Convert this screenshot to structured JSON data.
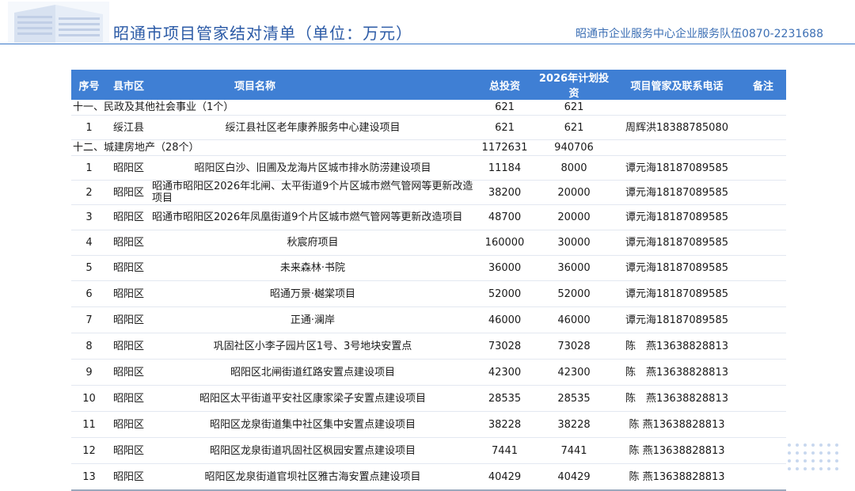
{
  "header": {
    "title": "昭通市项目管家结对清单（单位：万元）",
    "contact": "昭通市企业服务中心企业服务队伍0870-2231688"
  },
  "table": {
    "columns": [
      "序号",
      "县市区",
      "项目名称",
      "总投资",
      "2026年计划投资",
      "项目管家及联系电话",
      "备注"
    ],
    "rows": [
      {
        "type": "cat",
        "label": "十一、民政及其他社会事业（1个）",
        "total": "621",
        "plan": "621"
      },
      {
        "type": "item",
        "no": "1",
        "county": "绥江县",
        "name": "绥江县社区老年康养服务中心建设项目",
        "total": "621",
        "plan": "621",
        "manager": "周辉洪18388785080",
        "note": ""
      },
      {
        "type": "cat",
        "label": "十二、城建房地产（28个）",
        "total": "1172631",
        "plan": "940706"
      },
      {
        "type": "item",
        "no": "1",
        "county": "昭阳区",
        "name": "昭阳区白沙、旧圃及龙海片区城市排水防涝建设项目",
        "total": "11184",
        "plan": "8000",
        "manager": "谭元海18187089585",
        "note": ""
      },
      {
        "type": "item",
        "no": "2",
        "county": "昭阳区",
        "name": "昭通市昭阳区2026年北闸、太平街道9个片区城市燃气管网等更新改造项目",
        "total": "38200",
        "plan": "20000",
        "manager": "谭元海18187089585",
        "note": ""
      },
      {
        "type": "item",
        "no": "3",
        "county": "昭阳区",
        "name": "昭通市昭阳区2026年凤凰街道9个片区城市燃气管网等更新改造项目",
        "total": "48700",
        "plan": "20000",
        "manager": "谭元海18187089585",
        "note": ""
      },
      {
        "type": "item",
        "no": "4",
        "county": "昭阳区",
        "name": "秋宸府项目",
        "total": "160000",
        "plan": "30000",
        "manager": "谭元海18187089585",
        "note": ""
      },
      {
        "type": "item",
        "no": "5",
        "county": "昭阳区",
        "name": "未来森林·书院",
        "total": "36000",
        "plan": "36000",
        "manager": "谭元海18187089585",
        "note": ""
      },
      {
        "type": "item",
        "no": "6",
        "county": "昭阳区",
        "name": "昭通万景·樾棠项目",
        "total": "52000",
        "plan": "52000",
        "manager": "谭元海18187089585",
        "note": ""
      },
      {
        "type": "item",
        "no": "7",
        "county": "昭阳区",
        "name": "正通·澜岸",
        "total": "46000",
        "plan": "46000",
        "manager": "谭元海18187089585",
        "note": ""
      },
      {
        "type": "item",
        "no": "8",
        "county": "昭阳区",
        "name": "巩固社区小李子园片区1号、3号地块安置点",
        "total": "73028",
        "plan": "73028",
        "manager": "陈　燕13638828813",
        "note": ""
      },
      {
        "type": "item",
        "no": "9",
        "county": "昭阳区",
        "name": "昭阳区北闸街道红路安置点建设项目",
        "total": "42300",
        "plan": "42300",
        "manager": "陈　燕13638828813",
        "note": ""
      },
      {
        "type": "item",
        "no": "10",
        "county": "昭阳区",
        "name": "昭阳区太平街道平安社区康家梁子安置点建设项目",
        "total": "28535",
        "plan": "28535",
        "manager": "陈　燕13638828813",
        "note": ""
      },
      {
        "type": "item",
        "no": "11",
        "county": "昭阳区",
        "name": "昭阳区龙泉街道集中社区集中安置点建设项目",
        "total": "38228",
        "plan": "38228",
        "manager": "陈 燕13638828813",
        "note": ""
      },
      {
        "type": "item",
        "no": "12",
        "county": "昭阳区",
        "name": "昭阳区龙泉街道巩固社区枫园安置点建设项目",
        "total": "7441",
        "plan": "7441",
        "manager": "陈 燕13638828813",
        "note": ""
      },
      {
        "type": "item",
        "no": "13",
        "county": "昭阳区",
        "name": "昭阳区龙泉街道官坝社区雅古海安置点建设项目",
        "total": "40429",
        "plan": "40429",
        "manager": "陈 燕13638828813",
        "note": ""
      }
    ]
  },
  "colors": {
    "header_bg": "#3f7fd4",
    "title": "#2b5aa6",
    "rule": "#3a78c9"
  }
}
